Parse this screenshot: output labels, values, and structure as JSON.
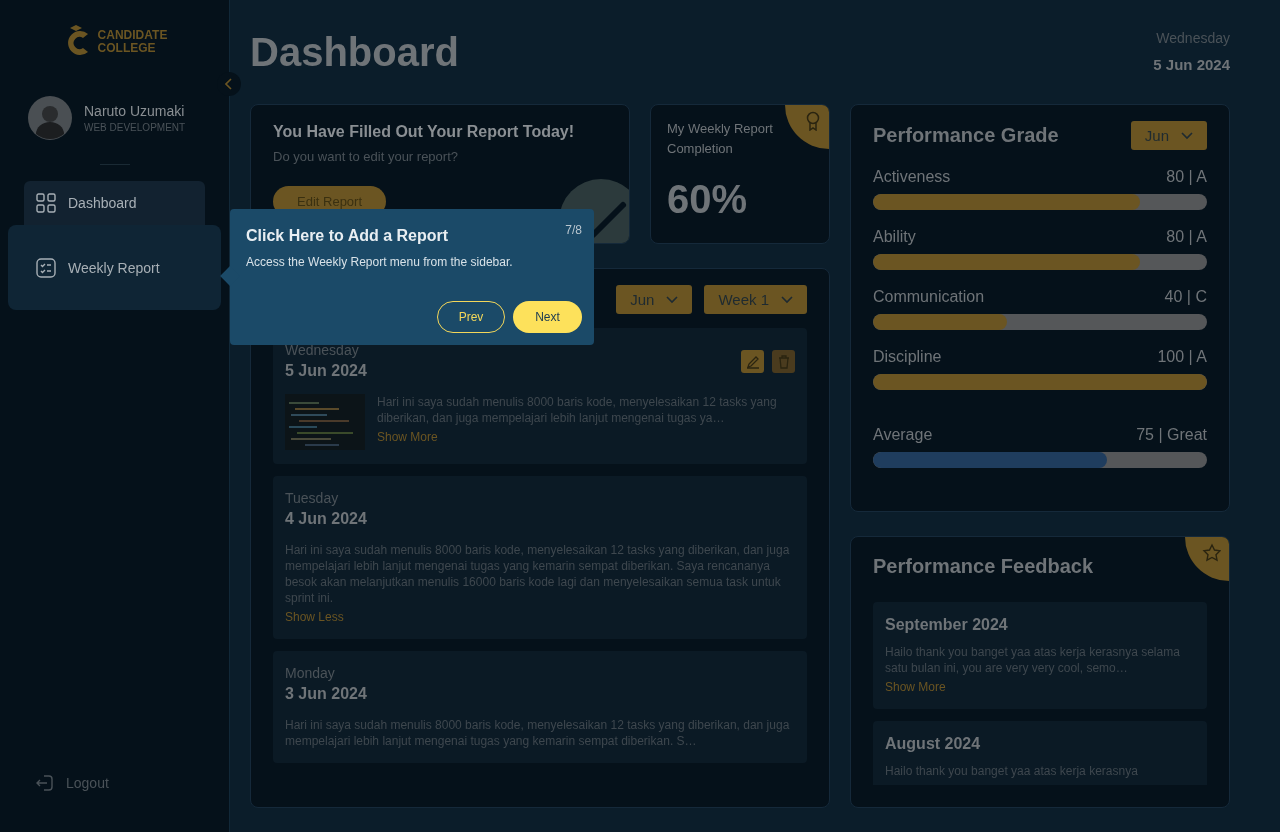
{
  "sidebar": {
    "logo": {
      "line1": "CANDIDATE",
      "line2": "COLLEGE"
    },
    "user": {
      "name": "Naruto Uzumaki",
      "role": "WEB DEVELOPMENT"
    },
    "nav": [
      {
        "label": "Dashboard",
        "selected": true,
        "spotlight": false
      },
      {
        "label": "Weekly Report",
        "selected": false,
        "spotlight": true
      }
    ],
    "logout": "Logout"
  },
  "header": {
    "title": "Dashboard",
    "day": "Wednesday",
    "date": "5 Jun 2024"
  },
  "report_card": {
    "title": "You Have Filled Out Your Report Today!",
    "subtitle": "Do you want to edit your report?",
    "button": "Edit Report"
  },
  "completion": {
    "label": "My Weekly Report Completion",
    "value": "60%"
  },
  "weekly": {
    "filters": [
      "Jun",
      "Week 1"
    ],
    "entries": [
      {
        "day": "Wednesday",
        "date": "5 Jun 2024",
        "image": true,
        "actions": true,
        "text": "Hari ini saya sudah menulis 8000 baris kode, menyelesaikan 12 tasks yang diberikan, dan juga mempelajari lebih lanjut mengenai tugas ya…",
        "link": "Show More"
      },
      {
        "day": "Tuesday",
        "date": "4 Jun 2024",
        "image": false,
        "actions": false,
        "text": "Hari ini saya sudah menulis 8000 baris kode, menyelesaikan 12 tasks yang diberikan, dan juga mempelajari lebih lanjut mengenai tugas yang kemarin sempat diberikan. Saya rencananya besok akan melanjutkan menulis 16000 baris kode lagi dan menyelesaikan semua task untuk sprint ini.",
        "link": "Show Less"
      },
      {
        "day": "Monday",
        "date": "3 Jun 2024",
        "image": false,
        "actions": false,
        "text": "Hari ini saya sudah menulis 8000 baris kode, menyelesaikan 12 tasks yang diberikan, dan juga mempelajari lebih lanjut mengenai tugas yang kemarin sempat diberikan. S…"
      }
    ]
  },
  "grade": {
    "title": "Performance Grade",
    "filter": "Jun",
    "rows": [
      {
        "kind": "metric",
        "label": "Activeness",
        "score": "80 | A",
        "level": 0.8
      },
      {
        "kind": "metric",
        "label": "Ability",
        "score": "80 | A",
        "level": 0.8
      },
      {
        "kind": "metric",
        "label": "Communication",
        "score": "40 | C",
        "level": 0.4
      },
      {
        "kind": "metric",
        "label": "Discipline",
        "score": "100 | A",
        "level": 1.0
      },
      {
        "kind": "average",
        "label": "Average",
        "score": "75 | Great",
        "level": 0.7
      }
    ]
  },
  "feedback": {
    "title": "Performance Feedback",
    "items": [
      {
        "month": "September 2024",
        "text": "Hailo thank you banget yaa atas kerja kerasnya selama satu bulan ini, you are very very cool, semo…",
        "link": "Show More"
      },
      {
        "month": "August 2024",
        "text": "Hailo thank you banget yaa atas kerja kerasnya"
      }
    ]
  },
  "tour": {
    "title": "Click Here to Add a Report",
    "body": "Access the Weekly Report menu from the sidebar.",
    "step": "7/8",
    "prev": "Prev",
    "next": "Next"
  }
}
